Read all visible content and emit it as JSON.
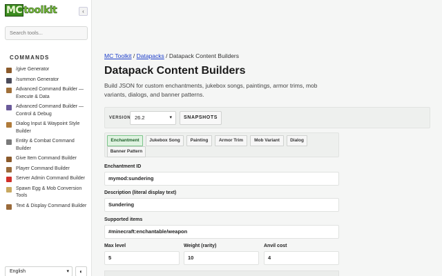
{
  "app": {
    "logo_mc": "MC",
    "logo_rest": "toolkit"
  },
  "sidebar": {
    "collapse_icon": "‹",
    "search_placeholder": "Search tools...",
    "section_title": "COMMANDS",
    "items": [
      {
        "label": "/give Generator",
        "icon_color": "#8b5a2b"
      },
      {
        "label": "/summon Generator",
        "icon_color": "#4b4b5a"
      },
      {
        "label": "Advanced Command Builder — Execute & Data",
        "icon_color": "#a0703a"
      },
      {
        "label": "Advanced Command Builder — Control & Debug",
        "icon_color": "#6a5a9a"
      },
      {
        "label": "Dialog Input & Waypoint Style Builder",
        "icon_color": "#b07b3a"
      },
      {
        "label": "Entity & Combat Command Builder",
        "icon_color": "#7a7a7a"
      },
      {
        "label": "Give Item Command Builder",
        "icon_color": "#8b5a2b"
      },
      {
        "label": "Player Command Builder",
        "icon_color": "#9a6a3a"
      },
      {
        "label": "Server Admin Command Builder",
        "icon_color": "#d0302a"
      },
      {
        "label": "Spawn Egg & Mob Conversion Tools",
        "icon_color": "#c8a860"
      },
      {
        "label": "Text & Display Command Builder",
        "icon_color": "#9a6a3a"
      }
    ],
    "language": "English",
    "theme_icon": "◐"
  },
  "main": {
    "breadcrumb": {
      "home": "MC Toolkit",
      "sep1": " / ",
      "section": "Datapacks",
      "sep2": " / ",
      "current": "Datapack Content Builders"
    },
    "title": "Datapack Content Builders",
    "subtitle": "Build JSON for custom enchantments, jukebox songs, paintings, armor trims, mob variants, dialogs, and banner patterns.",
    "version": {
      "label": "VERSION",
      "value": "26.2",
      "snapshots_label": "SNAPSHOTS"
    },
    "tabs": [
      {
        "label": "Enchantment",
        "active": true
      },
      {
        "label": "Jukebox Song",
        "active": false
      },
      {
        "label": "Painting",
        "active": false
      },
      {
        "label": "Armor Trim",
        "active": false
      },
      {
        "label": "Mob Variant",
        "active": false
      },
      {
        "label": "Dialog",
        "active": false
      },
      {
        "label": "Banner Pattern",
        "active": false
      }
    ],
    "form": {
      "enchantment_id": {
        "label": "Enchantment ID",
        "value": "mymod:sundering"
      },
      "description": {
        "label": "Description (literal display text)",
        "value": "Sundering"
      },
      "supported_items": {
        "label": "Supported items",
        "value": "#minecraft:enchantable/weapon"
      },
      "max_level": {
        "label": "Max level",
        "value": "5"
      },
      "weight": {
        "label": "Weight (rarity)",
        "value": "10"
      },
      "anvil_cost": {
        "label": "Anvil cost",
        "value": "4"
      }
    }
  }
}
